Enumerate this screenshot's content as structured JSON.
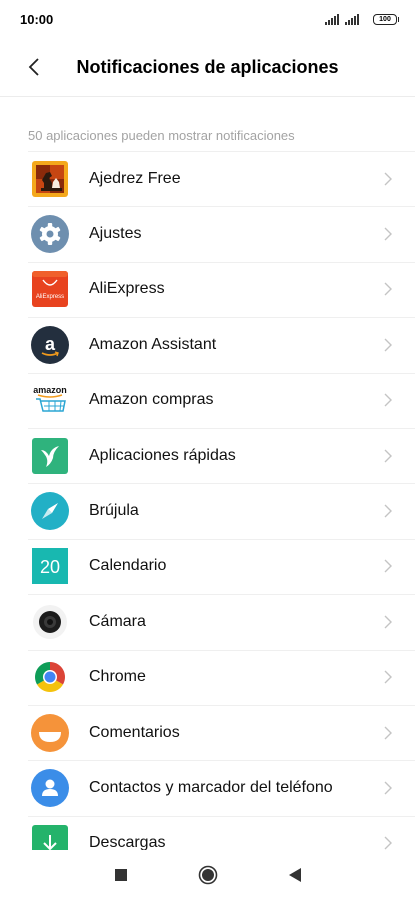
{
  "status_bar": {
    "time": "10:00",
    "battery": "100",
    "icons": [
      "signal-icon",
      "signal-icon",
      "battery-icon"
    ]
  },
  "header": {
    "title": "Notificaciones de aplicaciones",
    "back_icon": "back-arrow-icon"
  },
  "subtitle": "50 aplicaciones pueden mostrar notificaciones",
  "apps": [
    {
      "label": "Ajedrez Free",
      "icon": "chess-icon"
    },
    {
      "label": "Ajustes",
      "icon": "settings-gear-icon"
    },
    {
      "label": "AliExpress",
      "icon": "aliexpress-icon",
      "icon_text": "AliExpress"
    },
    {
      "label": "Amazon Assistant",
      "icon": "amazon-assistant-icon",
      "icon_text": "a"
    },
    {
      "label": "Amazon compras",
      "icon": "amazon-shopping-icon",
      "icon_text": "amazon"
    },
    {
      "label": "Aplicaciones rápidas",
      "icon": "quick-apps-icon"
    },
    {
      "label": "Brújula",
      "icon": "compass-icon"
    },
    {
      "label": "Calendario",
      "icon": "calendar-icon",
      "icon_text": "20"
    },
    {
      "label": "Cámara",
      "icon": "camera-icon"
    },
    {
      "label": "Chrome",
      "icon": "chrome-icon"
    },
    {
      "label": "Comentarios",
      "icon": "feedback-icon"
    },
    {
      "label": "Contactos y marcador del teléfono",
      "icon": "contacts-icon"
    },
    {
      "label": "Descargas",
      "icon": "downloads-icon"
    }
  ],
  "nav_bar": {
    "icons": [
      "recents-square-icon",
      "home-circle-icon",
      "back-triangle-icon"
    ]
  },
  "colors": {
    "subtitle": "#a3a3a3",
    "divider": "#efefef",
    "chevron": "#c4c4c4"
  }
}
